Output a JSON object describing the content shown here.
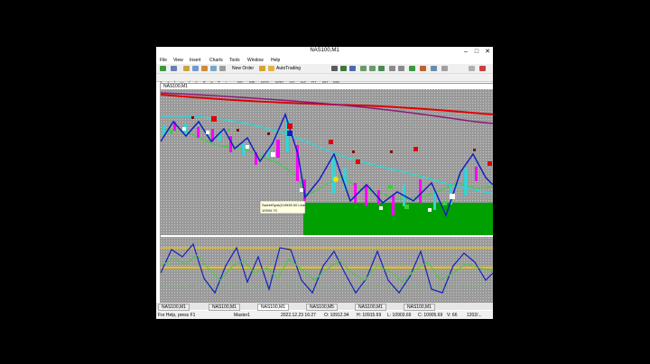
{
  "window": {
    "title": "NAS100,M1"
  },
  "menu": [
    "File",
    "View",
    "Insert",
    "Charts",
    "Tools",
    "Window",
    "Help"
  ],
  "toolbar": {
    "new_order": "New Order",
    "autotrading": "AutoTrading"
  },
  "chart": {
    "title": "NAS100,M1",
    "tooltip_line1": "SweetSpot(110935.00 Line",
    "tooltip_line2": "10934.73"
  },
  "tabs": [
    "NAS100,M1",
    "NAS100,M1",
    "NAS100,M1",
    "NAS100,M5",
    "NAS100,M1",
    "NAS100,M1"
  ],
  "active_tab": 3,
  "status": {
    "help": "For Help, press F1",
    "profile": "Master1",
    "datetime": "2022.12.23 16:27",
    "open": "O: 10912.94",
    "high": "H: 10915.69",
    "low": "L: 10903.69",
    "close": "C: 10905.69",
    "volume": "V: 66",
    "traffic": "1202/..."
  },
  "colors": {
    "accent_red": "#e00000",
    "cyan": "#35d3d3",
    "blue": "#1020c0",
    "magenta": "#ff00ff",
    "green": "#00a000",
    "yellow": "#f0c000"
  }
}
